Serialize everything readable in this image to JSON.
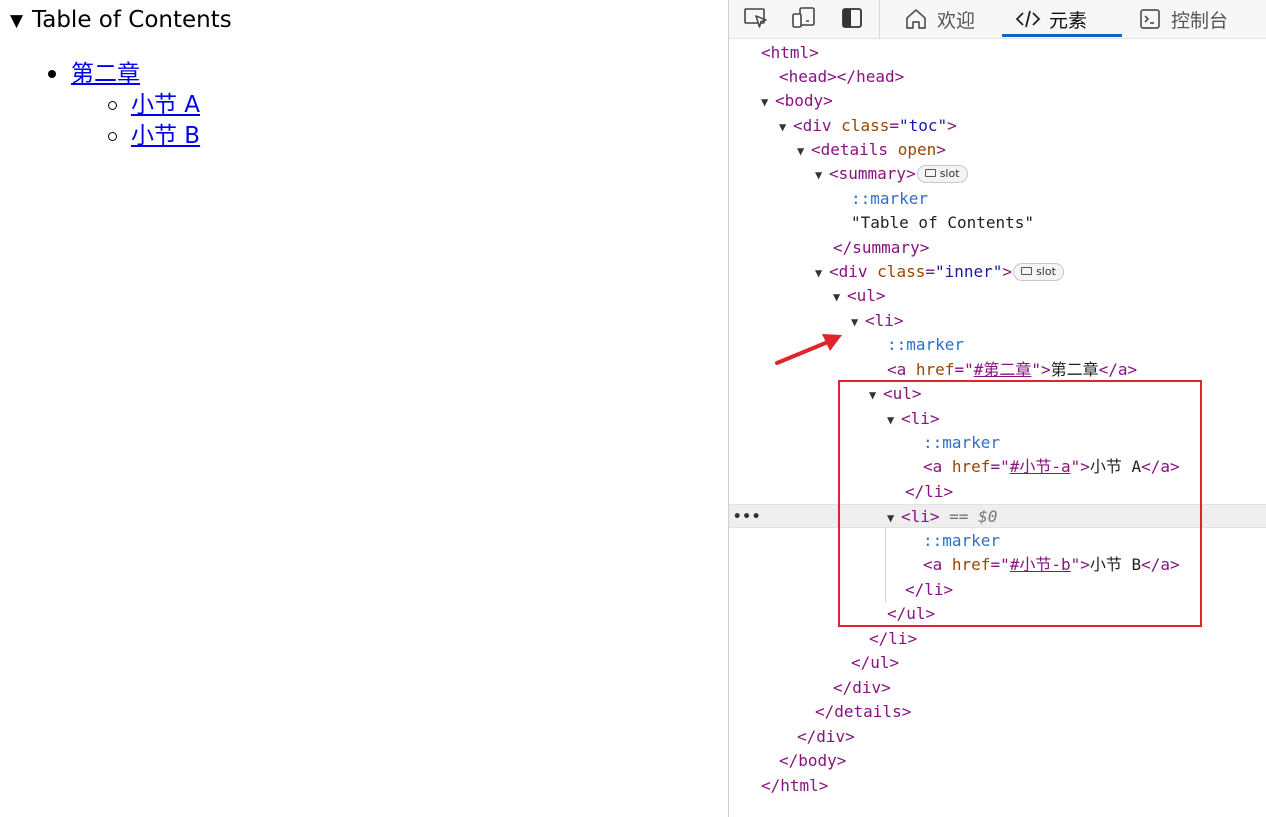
{
  "viewport": {
    "summary_text": "Table of Contents",
    "chapter_link": "第二章",
    "section_links": [
      "小节 A",
      "小节 B"
    ]
  },
  "devtools": {
    "tabs": [
      {
        "label": "欢迎",
        "icon": "home-icon"
      },
      {
        "label": "元素",
        "icon": "code-icon",
        "active": true
      },
      {
        "label": "控制台",
        "icon": "console-icon"
      }
    ],
    "tree": {
      "html_open": "<html>",
      "head": "<head></head>",
      "body_open": "<body>",
      "div_toc_tag": "<div",
      "div_toc_attr": "class",
      "div_toc_val": "\"toc\"",
      "details_tag": "<details",
      "details_attr": "open",
      "summary_open": "<summary>",
      "slot_label": "slot",
      "marker": "::marker",
      "summary_text": "\"Table of Contents\"",
      "summary_close": "</summary>",
      "div_inner_tag": "<div",
      "div_inner_attr": "class",
      "div_inner_val": "\"inner\"",
      "ul_open": "<ul>",
      "li_open": "<li>",
      "a_tag": "<a",
      "href_attr": "href",
      "chapter_href": "#第二章",
      "chapter_text": "第二章",
      "a_close": "</a>",
      "section_a_href": "#小节-a",
      "section_a_text": "小节 A",
      "li_close": "</li>",
      "selected_suffix": "== $0",
      "section_b_href": "#小节-b",
      "section_b_text": "小节 B",
      "ul_close": "</ul>",
      "div_close": "</div>",
      "details_close": "</details>",
      "body_close": "</body>",
      "html_close": "</html>",
      "more_dots": "•••"
    }
  },
  "colors": {
    "accent_underline": "#0a67c4",
    "highlight_box": "#e0242b",
    "arrow": "#e0242b",
    "tag": "#881280",
    "attr_name": "#994500",
    "attr_value": "#1a1aa6",
    "pseudo": "#2f6fc9",
    "link": "#0000ee"
  }
}
